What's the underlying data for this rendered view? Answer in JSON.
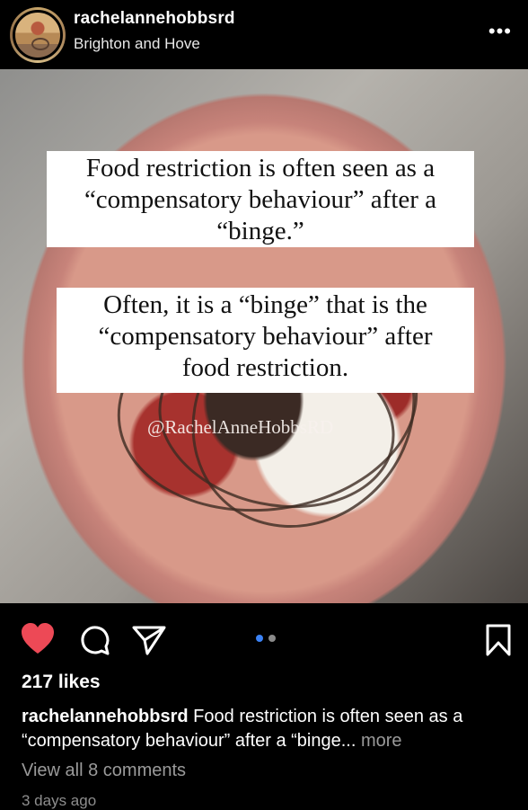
{
  "header": {
    "username": "rachelannehobbsrd",
    "location": "Brighton and Hove",
    "more_icon": "more-horizontal-icon",
    "more_label": "•••"
  },
  "post": {
    "overlay": {
      "box1": [
        "Food restriction is often seen as a",
        "“compensatory behaviour” after a",
        "“binge.”"
      ],
      "box2": [
        "Often, it is a “binge” that is the",
        "“compensatory behaviour” after",
        "food restriction."
      ],
      "watermark": "@RachelAnneHobbsRD"
    },
    "carousel": {
      "current": 1,
      "total": 2
    }
  },
  "actions": {
    "like_icon": "heart-filled-icon",
    "comment_icon": "comment-icon",
    "share_icon": "send-icon",
    "save_icon": "bookmark-icon",
    "like_color": "#ed4956"
  },
  "footer": {
    "likes": "217 likes",
    "caption_user": "rachelannehobbsrd",
    "caption_text": "Food restriction is often seen as a “compensatory behaviour” after a “binge...",
    "more_label": "more",
    "view_comments": "View all 8 comments",
    "timestamp": "3 days ago"
  }
}
